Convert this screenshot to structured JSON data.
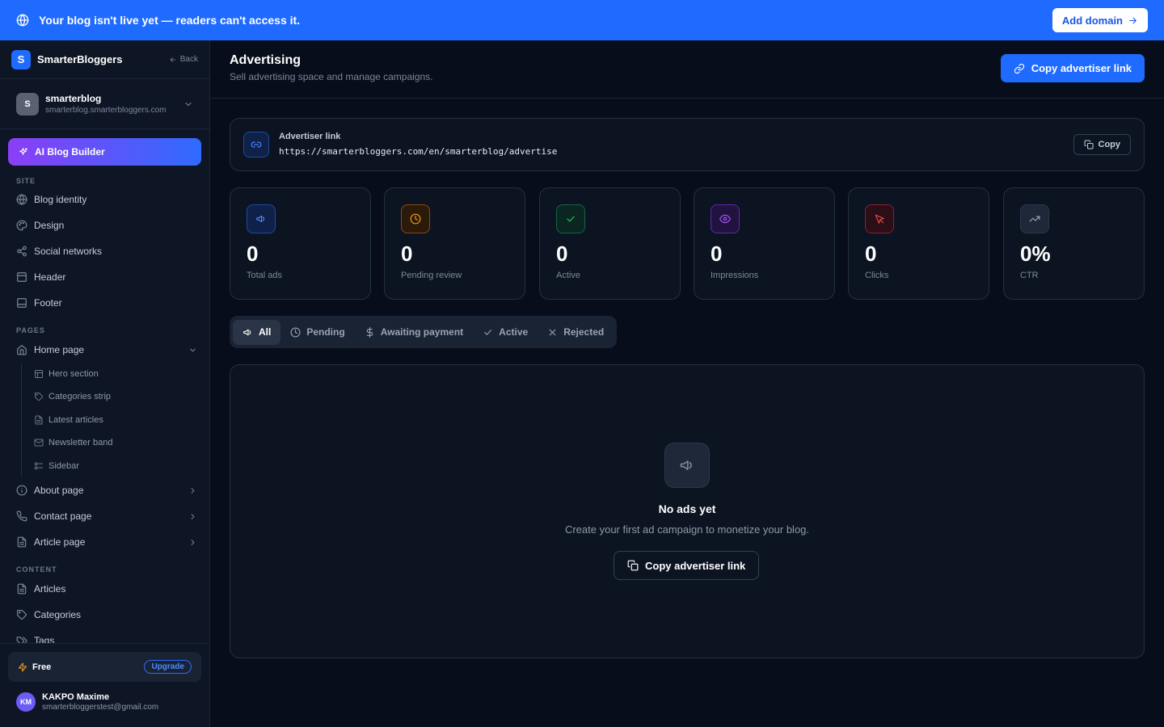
{
  "banner": {
    "message": "Your blog isn't live yet — readers can't access it.",
    "action": "Add domain",
    "icon": "globe-icon"
  },
  "brand": {
    "logo_letter": "S",
    "name": "SmarterBloggers",
    "back": "Back"
  },
  "blog": {
    "avatar": "S",
    "name": "smarterblog",
    "domain": "smarterblog.smarterbloggers.com"
  },
  "ai_builder": "AI Blog Builder",
  "sidebar": {
    "site_label": "SITE",
    "site_items": [
      {
        "label": "Blog identity",
        "icon": "globe-icon"
      },
      {
        "label": "Design",
        "icon": "palette-icon"
      },
      {
        "label": "Social networks",
        "icon": "share-icon"
      },
      {
        "label": "Header",
        "icon": "header-layout-icon"
      },
      {
        "label": "Footer",
        "icon": "footer-layout-icon"
      }
    ],
    "pages_label": "PAGES",
    "home": "Home page",
    "home_sub": [
      "Hero section",
      "Categories strip",
      "Latest articles",
      "Newsletter band",
      "Sidebar"
    ],
    "pages": [
      "About page",
      "Contact page",
      "Article page"
    ],
    "content_label": "CONTENT",
    "content_items": [
      "Articles",
      "Categories",
      "Tags"
    ]
  },
  "plan": {
    "name": "Free",
    "upgrade": "Upgrade"
  },
  "user": {
    "initials": "KM",
    "name": "KAKPO Maxime",
    "email": "smarterbloggerstest@gmail.com"
  },
  "page": {
    "title": "Advertising",
    "subtitle": "Sell advertising space and manage campaigns.",
    "primary_action": "Copy advertiser link"
  },
  "advertiser_link": {
    "label": "Advertiser link",
    "url": "https://smarterbloggers.com/en/smarterblog/advertise",
    "copy": "Copy"
  },
  "stats": [
    {
      "value": "0",
      "label": "Total ads",
      "icon": "megaphone-icon",
      "color": "#4b8bff"
    },
    {
      "value": "0",
      "label": "Pending review",
      "icon": "clock-icon",
      "color": "#f59e0b"
    },
    {
      "value": "0",
      "label": "Active",
      "icon": "check-icon",
      "color": "#22c55e"
    },
    {
      "value": "0",
      "label": "Impressions",
      "icon": "eye-icon",
      "color": "#a855f7"
    },
    {
      "value": "0",
      "label": "Clicks",
      "icon": "cursor-icon",
      "color": "#ef4444"
    },
    {
      "value": "0%",
      "label": "CTR",
      "icon": "trending-up-icon",
      "color": "#9aa3b2"
    }
  ],
  "tabs": [
    "All",
    "Pending",
    "Awaiting payment",
    "Active",
    "Rejected"
  ],
  "empty": {
    "title": "No ads yet",
    "text": "Create your first ad campaign to monetize your blog.",
    "action": "Copy advertiser link"
  }
}
